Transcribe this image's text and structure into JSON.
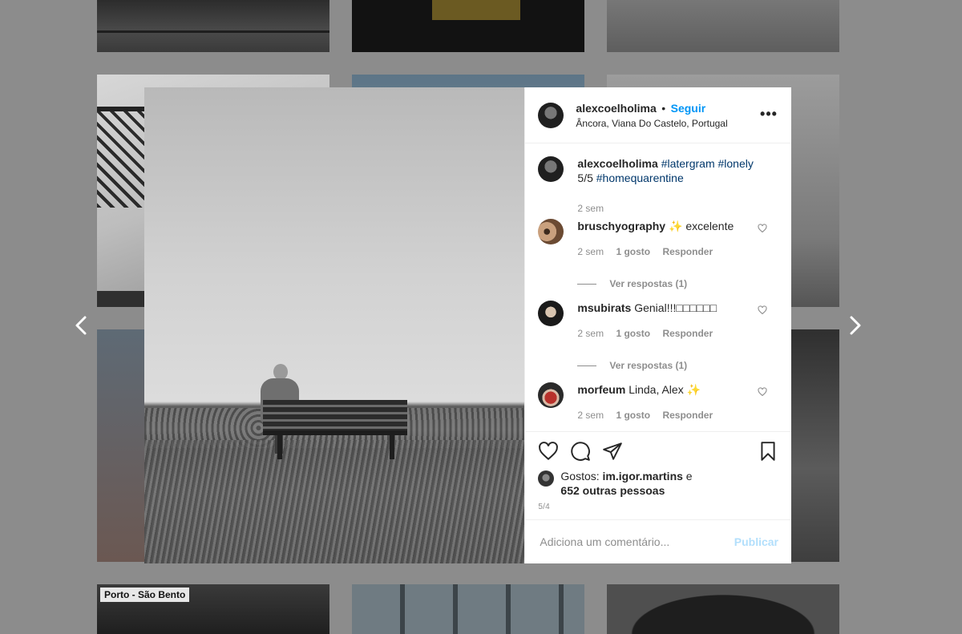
{
  "background_tiles": {
    "station_sign": "Porto - São Bento"
  },
  "post": {
    "author": "alexcoelholima",
    "separator": "•",
    "follow_label": "Seguir",
    "location": "Âncora, Viana Do Castelo, Portugal",
    "more_label": "•••"
  },
  "caption": {
    "user": "alexcoelholima",
    "tags_line1": "#latergram #lonely",
    "line2_prefix": "5/5",
    "tag_line2": "#homequarentine",
    "time": "2 sem"
  },
  "comments": [
    {
      "user": "bruschyography",
      "sparkle": "✨",
      "text": "excelente",
      "time": "2 sem",
      "likes": "1 gosto",
      "reply": "Responder",
      "view_replies": "Ver respostas (1)"
    },
    {
      "user": "msubirats",
      "sparkle": "",
      "text": "Genial!!!□□□□□□",
      "time": "2 sem",
      "likes": "1 gosto",
      "reply": "Responder",
      "view_replies": "Ver respostas (1)"
    },
    {
      "user": "morfeum",
      "sparkle": "✨",
      "text": "Linda, Alex",
      "time": "2 sem",
      "likes": "1 gosto",
      "reply": "Responder"
    }
  ],
  "likes": {
    "prefix": "Gostos:",
    "user": "im.igor.martins",
    "conjunction": "e",
    "others": "652 outras pessoas"
  },
  "date": "5/4",
  "add_comment": {
    "placeholder": "Adiciona um comentário...",
    "publish_label": "Publicar"
  },
  "colors": {
    "accent": "#0095f6",
    "hashtag": "#00376b",
    "muted": "#8e8e8e",
    "publish_disabled": "#b2dffc"
  },
  "icons": [
    "chevron-left-icon",
    "chevron-right-icon",
    "more-icon",
    "heart-icon",
    "comment-icon",
    "share-icon",
    "bookmark-icon"
  ]
}
